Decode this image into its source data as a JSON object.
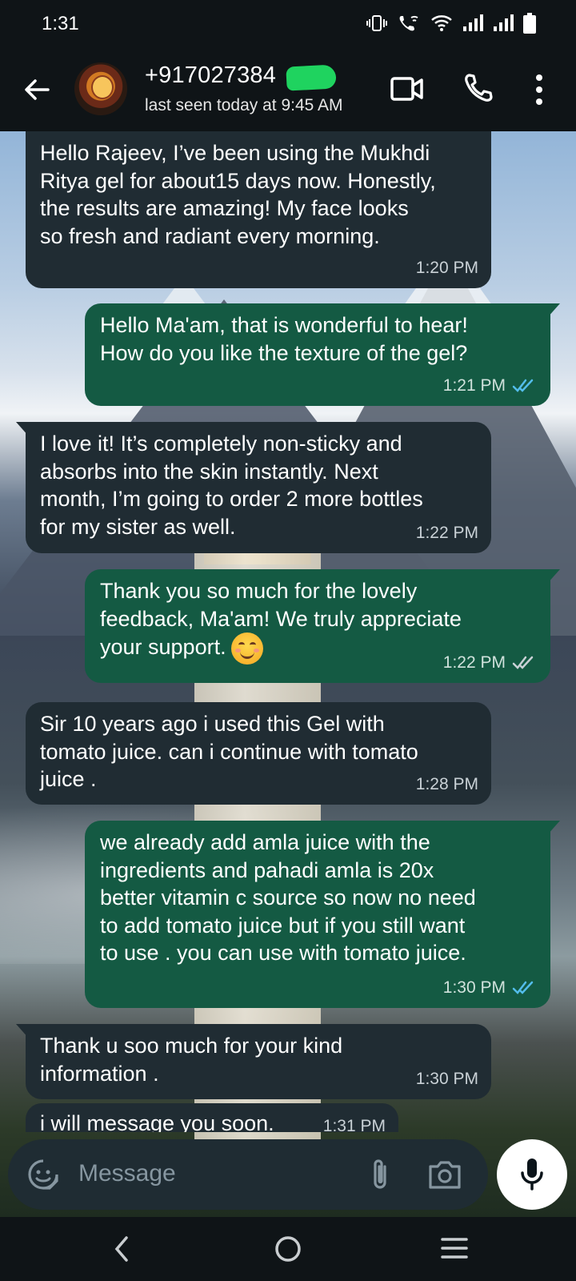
{
  "status_bar": {
    "time": "1:31",
    "icons": [
      "vibrate-icon",
      "wifi-calling-icon",
      "wifi-icon",
      "signal-icon",
      "signal-icon",
      "battery-icon"
    ]
  },
  "header": {
    "contact_name": "+917027384",
    "last_seen": "last seen today at 9:45 AM",
    "icons": [
      "back-arrow-icon",
      "avatar",
      "video-call-icon",
      "voice-call-icon",
      "more-options-icon"
    ]
  },
  "messages": [
    {
      "direction": "in",
      "text": "Hello Rajeev, I’ve been using the Mukhdi\nRitya gel for about15 days now. Honestly,\nthe results are amazing! My face looks\nso fresh and radiant every morning.",
      "time": "1:20 PM"
    },
    {
      "direction": "out",
      "text": "Hello Ma'am, that is wonderful to hear!\nHow do you like the texture of the gel?",
      "time": "1:21 PM",
      "status": "read"
    },
    {
      "direction": "in",
      "text": "I love it! It’s completely non-sticky and\nabsorbs into the skin instantly. Next\nmonth, I’m going to order 2 more bottles\nfor my sister as well.",
      "time": "1:22 PM"
    },
    {
      "direction": "out",
      "text": "Thank you so much for the lovely\nfeedback, Ma'am! We truly appreciate\nyour support.",
      "emoji": "smiling-face-icon",
      "time": "1:22 PM",
      "status": "delivered"
    },
    {
      "direction": "in",
      "text": "Sir 10 years ago i used this Gel with\ntomato juice. can i continue with tomato\njuice .",
      "time": "1:28 PM"
    },
    {
      "direction": "out",
      "text": "we already add amla juice with the\ningredients and pahadi amla is 20x\nbetter vitamin c source so now no need\nto add tomato juice but if you still want\nto use . you can use with tomato juice.",
      "time": "1:30 PM",
      "status": "read"
    },
    {
      "direction": "in",
      "text": "Thank u soo much for your kind\ninformation .",
      "time": "1:30 PM"
    },
    {
      "direction": "in",
      "text": "i will message you soon.",
      "time": "1:31 PM"
    }
  ],
  "input": {
    "placeholder": "Message",
    "icons": [
      "sticker-icon",
      "attach-icon",
      "camera-icon",
      "mic-icon"
    ]
  },
  "nav": {
    "icons": [
      "back-nav-icon",
      "home-nav-icon",
      "recents-nav-icon"
    ]
  },
  "colors": {
    "header_bg": "#0f1417",
    "incoming_bubble": "#202c33",
    "outgoing_bubble": "#145a43",
    "read_ticks": "#53bdeb",
    "delivered_ticks": "#c9d1d6"
  }
}
